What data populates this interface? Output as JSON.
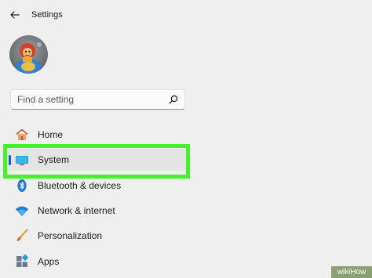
{
  "window": {
    "title": "Settings",
    "back_icon": "back-arrow-icon"
  },
  "profile": {
    "avatar_icon": "user-avatar"
  },
  "search": {
    "placeholder": "Find a setting",
    "value": "",
    "icon": "search-icon"
  },
  "sidebar": {
    "items": [
      {
        "label": "Home",
        "icon": "home-icon",
        "selected": false
      },
      {
        "label": "System",
        "icon": "system-display-icon",
        "selected": true
      },
      {
        "label": "Bluetooth & devices",
        "icon": "bluetooth-icon",
        "selected": false
      },
      {
        "label": "Network & internet",
        "icon": "wifi-icon",
        "selected": false
      },
      {
        "label": "Personalization",
        "icon": "brush-icon",
        "selected": false
      },
      {
        "label": "Apps",
        "icon": "apps-icon",
        "selected": false
      }
    ]
  },
  "colors": {
    "accent": "#0067c0",
    "highlight": "#44f22a",
    "background": "#efefef"
  },
  "watermark": {
    "text": "wikiHow"
  }
}
